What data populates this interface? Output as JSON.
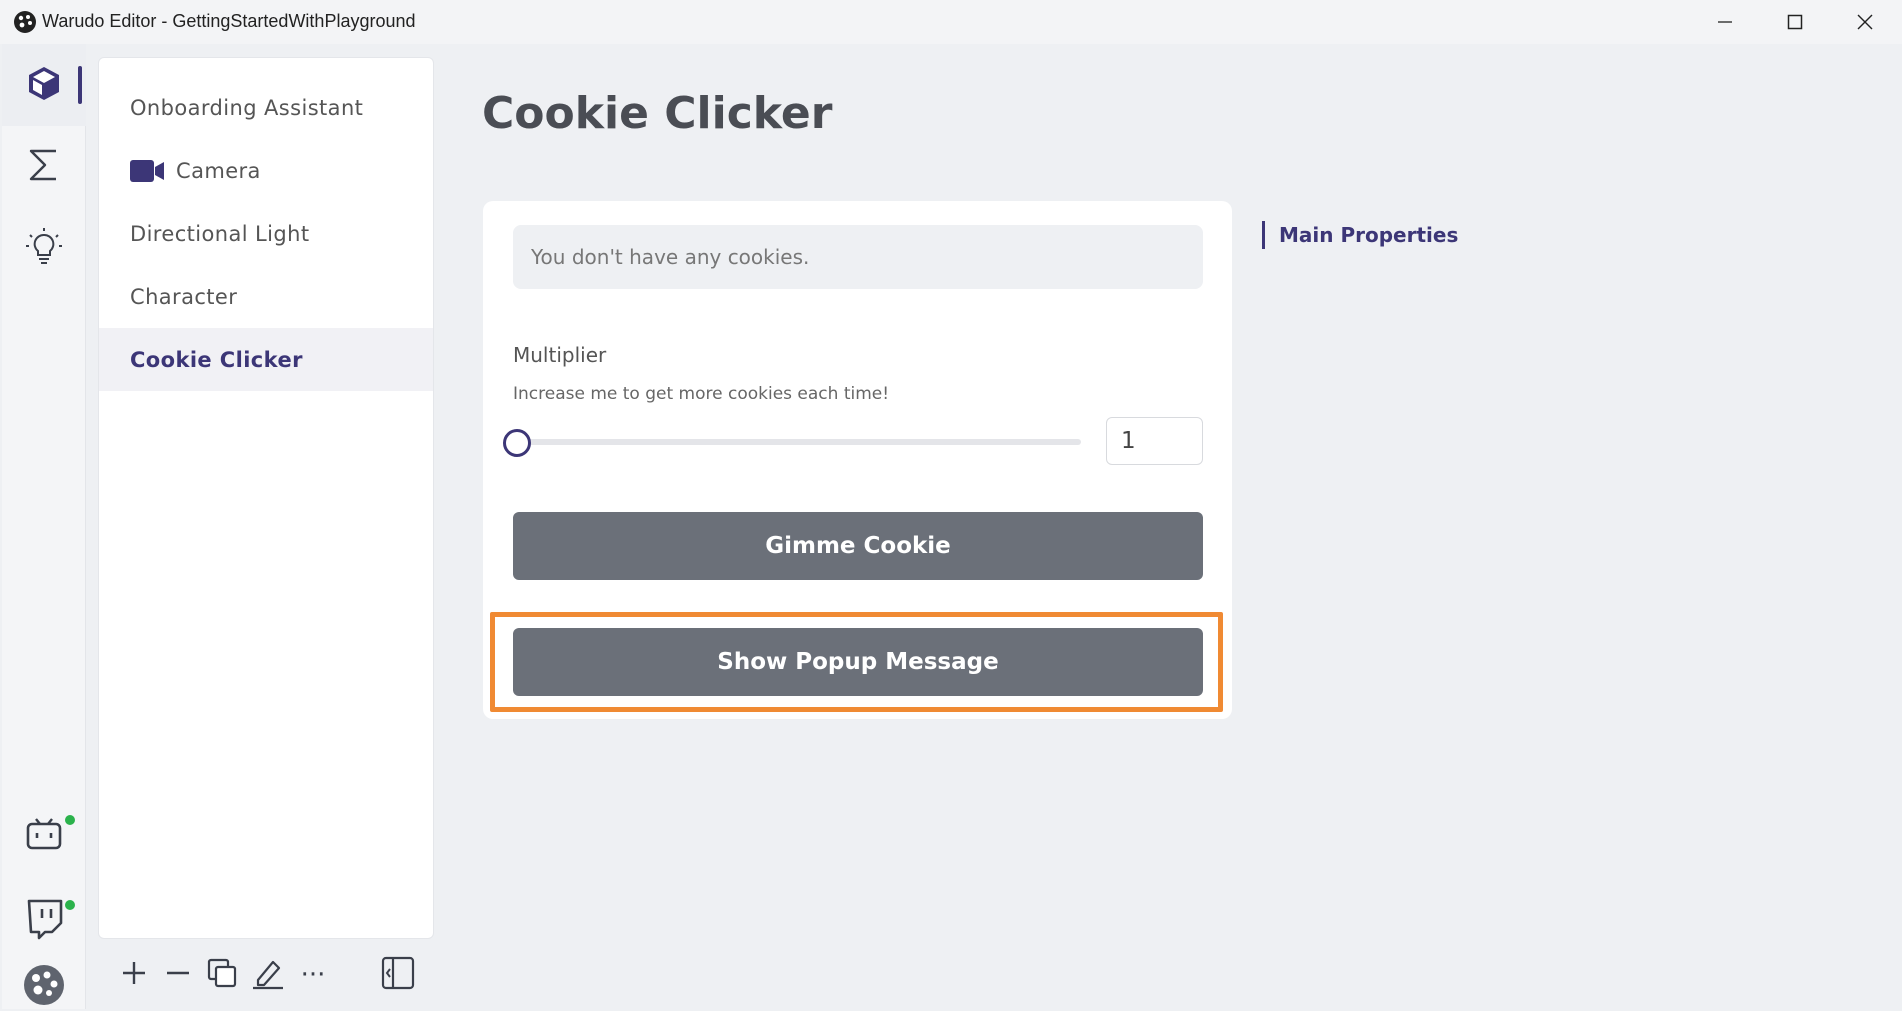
{
  "window": {
    "title": "Warudo Editor - GettingStartedWithPlayground"
  },
  "rail": {
    "items": [
      {
        "name": "scene",
        "icon": "cube-icon"
      },
      {
        "name": "blueprints",
        "icon": "sigma-icon"
      },
      {
        "name": "tips",
        "icon": "lightbulb-icon"
      },
      {
        "name": "bilibili",
        "icon": "bilibili-icon",
        "online": true
      },
      {
        "name": "twitch",
        "icon": "twitch-icon",
        "online": true
      },
      {
        "name": "warudo",
        "icon": "warudo-logo-icon"
      }
    ]
  },
  "asset_list": {
    "items": [
      {
        "label": "Onboarding Assistant"
      },
      {
        "label": "Camera",
        "icon": "video-camera-icon"
      },
      {
        "label": "Directional Light"
      },
      {
        "label": "Character"
      },
      {
        "label": "Cookie Clicker",
        "selected": true
      }
    ]
  },
  "toolbar": {
    "buttons": [
      "add-icon",
      "remove-icon",
      "duplicate-icon",
      "rename-icon",
      "more-icon",
      "collapse-panel-icon"
    ],
    "more_label": "···"
  },
  "main": {
    "title": "Cookie Clicker",
    "info_text": "You don't have any cookies.",
    "multiplier": {
      "label": "Multiplier",
      "description": "Increase me to get more cookies each time!",
      "value": "1",
      "slider_fraction": 0.0
    },
    "gimme_button": "Gimme Cookie",
    "popup_button": "Show Popup Message"
  },
  "side_nav": {
    "section": "Main Properties"
  },
  "colors": {
    "accent": "#3c3677",
    "highlight": "#f08a33",
    "button": "#6b7079",
    "status_online": "#2bb24c"
  }
}
